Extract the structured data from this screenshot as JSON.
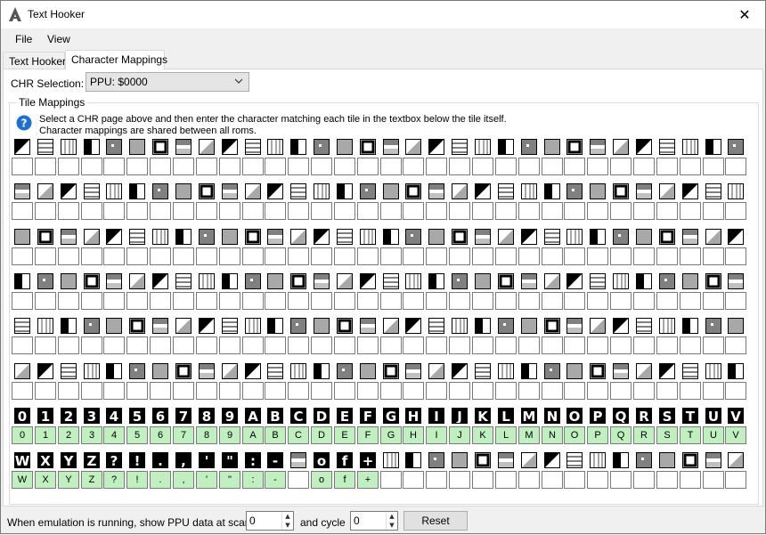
{
  "window": {
    "title": "Text Hooker",
    "close_glyph": "✕",
    "icon": "app-logo-icon"
  },
  "menu": {
    "items": [
      "File",
      "View"
    ]
  },
  "tabs": [
    {
      "label": "Text Hooker",
      "active": false
    },
    {
      "label": "Character Mappings",
      "active": true
    }
  ],
  "chr_selection": {
    "label": "CHR Selection:",
    "value": "PPU: $0000"
  },
  "tile_mappings": {
    "title": "Tile Mappings",
    "help_line1": "Select a CHR page above and then enter the character matching each tile in the textbox below the tile itself.",
    "help_line2": "Character mappings are shared between all roms.",
    "icon": "help-icon",
    "rows": [
      [
        "",
        "",
        "",
        "",
        "",
        "",
        "",
        "",
        "",
        "",
        "",
        "",
        "",
        "",
        "",
        "",
        "",
        "",
        "",
        "",
        "",
        "",
        "",
        "",
        "",
        "",
        "",
        "",
        "",
        "",
        "",
        ""
      ],
      [
        "",
        "",
        "",
        "",
        "",
        "",
        "",
        "",
        "",
        "",
        "",
        "",
        "",
        "",
        "",
        "",
        "",
        "",
        "",
        "",
        "",
        "",
        "",
        "",
        "",
        "",
        "",
        "",
        "",
        "",
        "",
        ""
      ],
      [
        "",
        "",
        "",
        "",
        "",
        "",
        "",
        "",
        "",
        "",
        "",
        "",
        "",
        "",
        "",
        "",
        "",
        "",
        "",
        "",
        "",
        "",
        "",
        "",
        "",
        "",
        "",
        "",
        "",
        "",
        "",
        ""
      ],
      [
        "",
        "",
        "",
        "",
        "",
        "",
        "",
        "",
        "",
        "",
        "",
        "",
        "",
        "",
        "",
        "",
        "",
        "",
        "",
        "",
        "",
        "",
        "",
        "",
        "",
        "",
        "",
        "",
        "",
        "",
        "",
        ""
      ],
      [
        "",
        "",
        "",
        "",
        "",
        "",
        "",
        "",
        "",
        "",
        "",
        "",
        "",
        "",
        "",
        "",
        "",
        "",
        "",
        "",
        "",
        "",
        "",
        "",
        "",
        "",
        "",
        "",
        "",
        "",
        "",
        ""
      ],
      [
        "",
        "",
        "",
        "",
        "",
        "",
        "",
        "",
        "",
        "",
        "",
        "",
        "",
        "",
        "",
        "",
        "",
        "",
        "",
        "",
        "",
        "",
        "",
        "",
        "",
        "",
        "",
        "",
        "",
        "",
        "",
        ""
      ],
      [
        "0",
        "1",
        "2",
        "3",
        "4",
        "5",
        "6",
        "7",
        "8",
        "9",
        "A",
        "B",
        "C",
        "D",
        "E",
        "F",
        "G",
        "H",
        "I",
        "J",
        "K",
        "L",
        "M",
        "N",
        "O",
        "P",
        "Q",
        "R",
        "S",
        "T",
        "U",
        "V"
      ],
      [
        "W",
        "X",
        "Y",
        "Z",
        "?",
        "!",
        ".",
        ",",
        "'",
        "\"",
        ":",
        "-",
        "",
        "o",
        "f",
        "+",
        "",
        "",
        "",
        "",
        "",
        "",
        "",
        "",
        "",
        "",
        "",
        "",
        "",
        "",
        "",
        ""
      ]
    ]
  },
  "bottom": {
    "scanline_label": "When emulation is running, show PPU data at scanline",
    "scanline_value": "0",
    "cycle_label": "and cycle",
    "cycle_value": "0",
    "reset_label": "Reset",
    "spin_up": "▲",
    "spin_down": "▼"
  },
  "colors": {
    "mapped_box": "#c0f0c0",
    "tile_dark": "#000000",
    "tile_mid": "#808080",
    "tile_light": "#a8a8a8"
  }
}
